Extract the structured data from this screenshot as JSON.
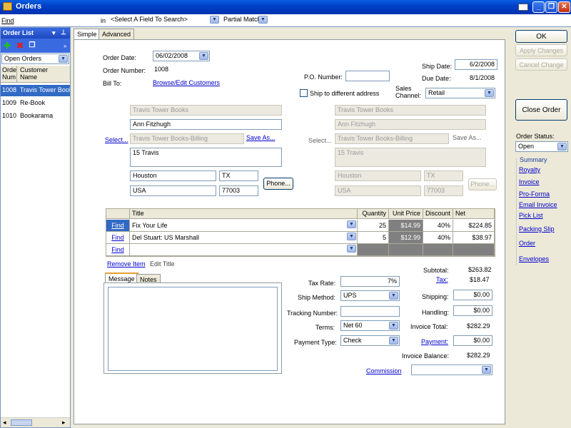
{
  "window": {
    "title": "Orders"
  },
  "search": {
    "find_label": "Find",
    "in_label": "in",
    "field_select": "<Select A Field To Search>",
    "match_select": "Partial Match"
  },
  "order_list": {
    "title": "Order List",
    "filter": "Open Orders",
    "col_num": "Order Num",
    "col_name": "Customer Name",
    "rows": [
      {
        "num": "1008",
        "name": "Travis Tower Books"
      },
      {
        "num": "1009",
        "name": "Re-Book"
      },
      {
        "num": "1010",
        "name": "Bookarama"
      }
    ]
  },
  "tabs": {
    "simple": "Simple",
    "advanced": "Advanced"
  },
  "header": {
    "order_date_label": "Order Date:",
    "order_date": "06/02/2008",
    "order_number_label": "Order Number:",
    "order_number": "1008",
    "bill_to_label": "Bill To:",
    "browse_customers": "Browse/Edit Customers",
    "po_label": "P.O. Number:",
    "po_value": "",
    "ship_diff_label": "Ship to different address",
    "ship_date_label": "Ship Date:",
    "ship_date": "6/2/2008",
    "due_date_label": "Due Date:",
    "due_date": "8/1/2008",
    "sales_channel_label": "Sales Channel:",
    "sales_channel": "Retail"
  },
  "bill": {
    "company": "Travis Tower Books",
    "contact": "Ann Fitzhugh",
    "select_link": "Select...",
    "address_name": "Travis Tower Books-Billing",
    "save_as": "Save As...",
    "street": "15 Travis",
    "city": "Houston",
    "state": "TX",
    "country": "USA",
    "zip": "77003",
    "phone_btn": "Phone..."
  },
  "ship": {
    "company": "Travis Tower Books",
    "contact": "Ann Fitzhugh",
    "select_link": "Select...",
    "address_name": "Travis Tower Books-Billing",
    "save_as": "Save As...",
    "street": "15 Travis",
    "city": "Houston",
    "state": "TX",
    "country": "USA",
    "zip": "77003",
    "phone_btn": "Phone..."
  },
  "items": {
    "col_title": "Title",
    "col_qty": "Quantity",
    "col_price": "Unit Price",
    "col_disc": "Discount",
    "col_net": "Net",
    "rows": [
      {
        "find": "Find",
        "title": "Fix Your Life",
        "qty": "25",
        "price": "$14.99",
        "disc": "40%",
        "net": "$224.85"
      },
      {
        "find": "Find",
        "title": "Del Stuart: US Marshall",
        "qty": "5",
        "price": "$12.99",
        "disc": "40%",
        "net": "$38.97"
      },
      {
        "find": "Find",
        "title": "",
        "qty": "",
        "price": "",
        "disc": "",
        "net": ""
      }
    ],
    "remove_item": "Remove Item",
    "edit_title": "Edit Title"
  },
  "notes": {
    "message_tab": "Message",
    "notes_tab": "Notes"
  },
  "shipping": {
    "tax_rate_label": "Tax Rate:",
    "tax_rate": "7%",
    "ship_method_label": "Ship Method:",
    "ship_method": "UPS",
    "tracking_label": "Tracking Number:",
    "tracking": "",
    "terms_label": "Terms:",
    "terms": "Net 60",
    "payment_type_label": "Payment Type:",
    "payment_type": "Check",
    "commission_label": "Commission"
  },
  "totals": {
    "subtotal_label": "Subtotal:",
    "subtotal": "$263.82",
    "tax_label": "Tax:",
    "tax": "$18.47",
    "shipping_label": "Shipping:",
    "shipping": "$0.00",
    "handling_label": "Handling:",
    "handling": "$0.00",
    "invoice_total_label": "Invoice Total:",
    "invoice_total": "$282.29",
    "payment_label": "Payment:",
    "payment": "$0.00",
    "balance_label": "Invoice Balance:",
    "balance": "$282.29"
  },
  "actions": {
    "ok": "OK",
    "apply": "Apply Changes",
    "cancel": "Cancel Change",
    "close_order": "Close Order",
    "status_label": "Order Status:",
    "status": "Open",
    "summary": "Summary",
    "links": [
      "Royalty",
      "Invoice",
      "Pro-Forma",
      "Email Invoice",
      "Pick List",
      "Packing Slip",
      "Order",
      "Envelopes"
    ]
  }
}
